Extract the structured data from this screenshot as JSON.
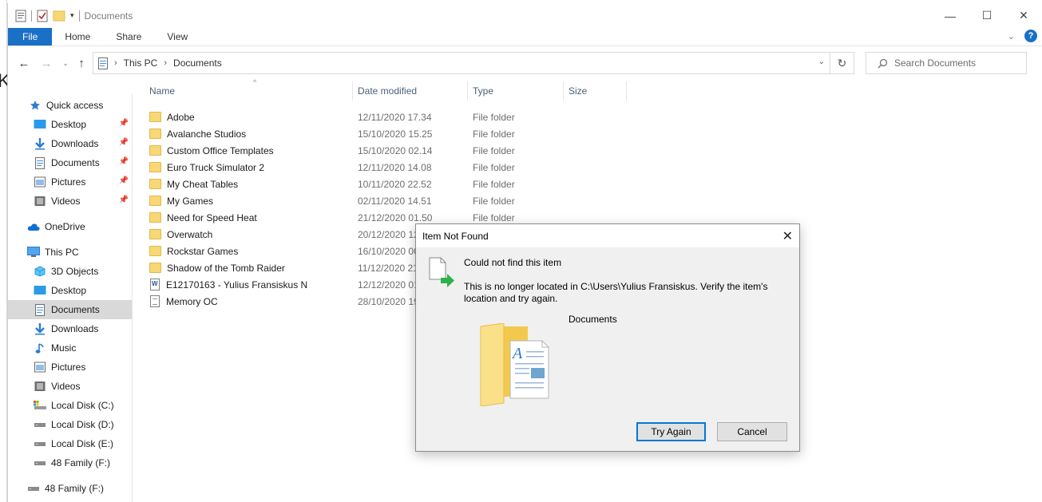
{
  "window": {
    "title": "Documents"
  },
  "ribbon": {
    "tabs": [
      "File",
      "Home",
      "Share",
      "View"
    ]
  },
  "address": {
    "crumbs": [
      "This PC",
      "Documents"
    ],
    "search_placeholder": "Search Documents"
  },
  "nav": {
    "items": [
      {
        "label": "Quick access",
        "icon": "star-icon"
      },
      {
        "label": "Desktop",
        "icon": "desktop-icon",
        "pinned": true
      },
      {
        "label": "Downloads",
        "icon": "download-icon",
        "pinned": true
      },
      {
        "label": "Documents",
        "icon": "documents-icon",
        "pinned": true
      },
      {
        "label": "Pictures",
        "icon": "pictures-icon",
        "pinned": true
      },
      {
        "label": "Videos",
        "icon": "videos-icon",
        "pinned": true
      },
      {
        "label": "OneDrive",
        "icon": "cloud-icon"
      },
      {
        "label": "This PC",
        "icon": "computer-icon"
      },
      {
        "label": "3D Objects",
        "icon": "cube-icon"
      },
      {
        "label": "Desktop",
        "icon": "desktop-icon"
      },
      {
        "label": "Documents",
        "icon": "documents-icon",
        "selected": true
      },
      {
        "label": "Downloads",
        "icon": "download-icon"
      },
      {
        "label": "Music",
        "icon": "music-icon"
      },
      {
        "label": "Pictures",
        "icon": "pictures-icon"
      },
      {
        "label": "Videos",
        "icon": "videos-icon"
      },
      {
        "label": "Local Disk (C:)",
        "icon": "system-drive-icon"
      },
      {
        "label": "Local Disk (D:)",
        "icon": "drive-icon"
      },
      {
        "label": "Local Disk (E:)",
        "icon": "drive-icon"
      },
      {
        "label": "48 Family (F:)",
        "icon": "drive-icon"
      },
      {
        "label": "48 Family (F:)",
        "icon": "drive-icon"
      }
    ]
  },
  "columns": [
    "Name",
    "Date modified",
    "Type",
    "Size"
  ],
  "files": [
    {
      "name": "Adobe",
      "date": "12/11/2020 17.34",
      "type": "File folder",
      "kind": "folder"
    },
    {
      "name": "Avalanche Studios",
      "date": "15/10/2020 15.25",
      "type": "File folder",
      "kind": "folder"
    },
    {
      "name": "Custom Office Templates",
      "date": "15/10/2020 02.14",
      "type": "File folder",
      "kind": "folder"
    },
    {
      "name": "Euro Truck Simulator 2",
      "date": "12/11/2020 14.08",
      "type": "File folder",
      "kind": "folder"
    },
    {
      "name": "My Cheat Tables",
      "date": "10/11/2020 22.52",
      "type": "File folder",
      "kind": "folder"
    },
    {
      "name": "My Games",
      "date": "02/11/2020 14.51",
      "type": "File folder",
      "kind": "folder"
    },
    {
      "name": "Need for Speed Heat",
      "date": "21/12/2020 01.50",
      "type": "File folder",
      "kind": "folder"
    },
    {
      "name": "Overwatch",
      "date": "20/12/2020 12",
      "type": "",
      "kind": "folder"
    },
    {
      "name": "Rockstar Games",
      "date": "16/10/2020 00",
      "type": "",
      "kind": "folder"
    },
    {
      "name": "Shadow of the Tomb Raider",
      "date": "11/12/2020 21",
      "type": "",
      "kind": "folder"
    },
    {
      "name": "E12170163 - Yulius Fransiskus N",
      "date": "12/12/2020 01",
      "type": "",
      "kind": "word"
    },
    {
      "name": "Memory OC",
      "date": "28/10/2020 19",
      "type": "",
      "kind": "txt"
    }
  ],
  "dialog": {
    "title": "Item Not Found",
    "heading": "Could not find this item",
    "message": "This is no longer located in C:\\Users\\Yulius Fransiskus. Verify the item's location and try again.",
    "caption": "Documents",
    "try_again": "Try Again",
    "cancel": "Cancel"
  },
  "colors": {
    "accent": "#1a6fc6",
    "folder": "#f8d775",
    "selected": "#d9d9d9"
  }
}
